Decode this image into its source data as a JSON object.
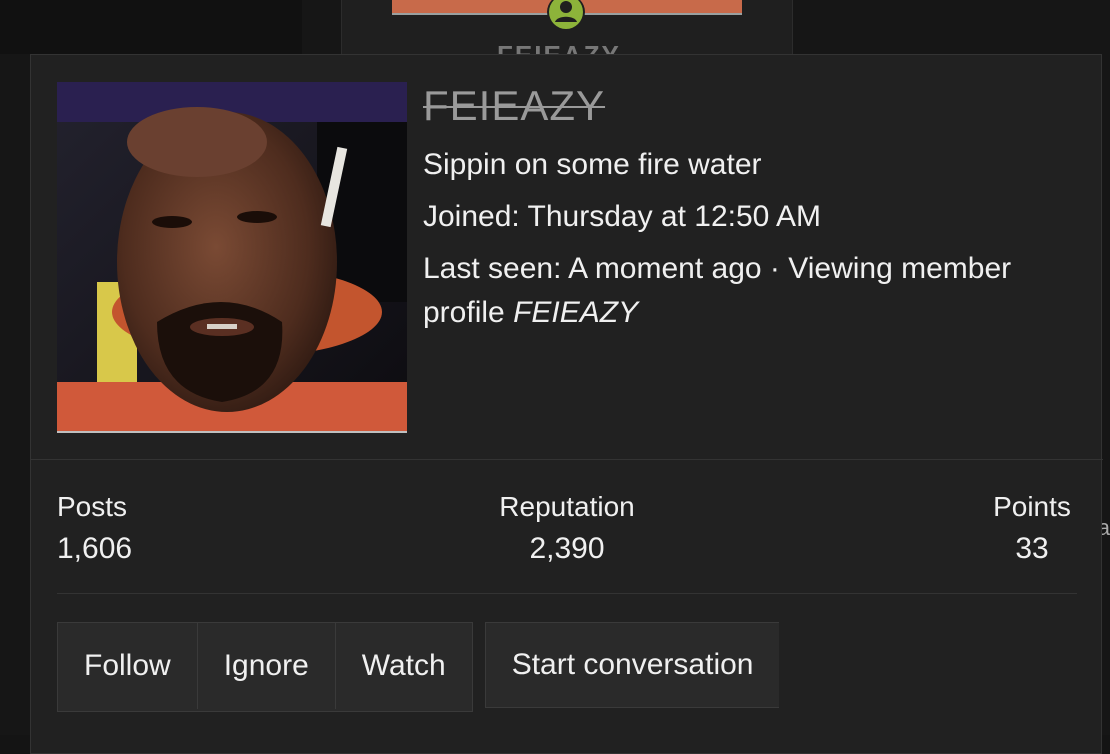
{
  "background": {
    "username": "FEIEAZY",
    "edge_text": "a"
  },
  "card": {
    "username": "FEIEAZY",
    "custom_title": "Sippin on some fire water",
    "joined_label": "Joined:",
    "joined_value": "Thursday at 12:50 AM",
    "last_seen_label": "Last seen:",
    "last_seen_value": "A moment ago",
    "separator": "·",
    "activity": "Viewing member profile",
    "activity_target": "FEIEAZY",
    "avatar_alt": "FEIEAZY avatar"
  },
  "stats": {
    "posts_label": "Posts",
    "posts_value": "1,606",
    "reputation_label": "Reputation",
    "reputation_value": "2,390",
    "points_label": "Points",
    "points_value": "33"
  },
  "actions": {
    "follow": "Follow",
    "ignore": "Ignore",
    "watch": "Watch",
    "start_conversation": "Start conversation"
  },
  "colors": {
    "card_bg": "#212121",
    "page_bg": "#161616",
    "text": "#f0f0f0",
    "username_muted": "#9a9a9a",
    "user_icon_green": "#8db33a",
    "banner_orange": "#c86a4a"
  }
}
